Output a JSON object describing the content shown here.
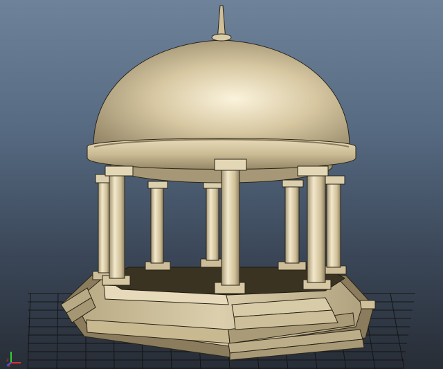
{
  "viewport": {
    "type": "3d-perspective-viewport",
    "background_gradient": [
      "#6e829a",
      "#566a82",
      "#3a4657",
      "#272d36"
    ],
    "grid_visible": true,
    "grid_color": "#000000",
    "model_color": "#d2c3a0",
    "shadow_color": "#3b3322"
  },
  "axis_gizmo": {
    "x_label": "x",
    "z_label": "z",
    "x_color": "#e03030",
    "y_color": "#30d030",
    "z_color": "#3060ff"
  }
}
